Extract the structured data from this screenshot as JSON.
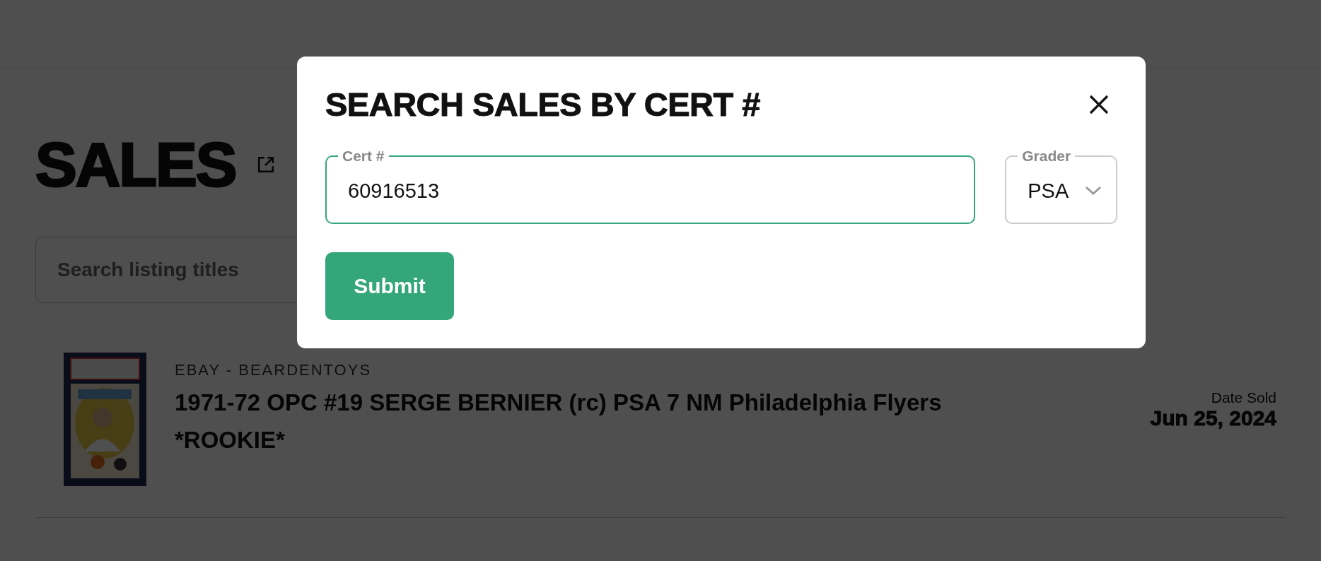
{
  "page": {
    "title": "SALES",
    "search": {
      "placeholder": "Search listing titles"
    },
    "listings": [
      {
        "source": "EBAY - BEARDENTOYS",
        "title": "1971-72 OPC #19 SERGE BERNIER (rc) PSA 7 NM Philadelphia Flyers *ROOKIE*",
        "date_label": "Date Sold",
        "date": "Jun 25, 2024"
      }
    ]
  },
  "modal": {
    "title": "SEARCH SALES BY CERT #",
    "cert_field": {
      "label": "Cert #",
      "value": "60916513"
    },
    "grader": {
      "label": "Grader",
      "value": "PSA"
    },
    "submit": "Submit"
  }
}
